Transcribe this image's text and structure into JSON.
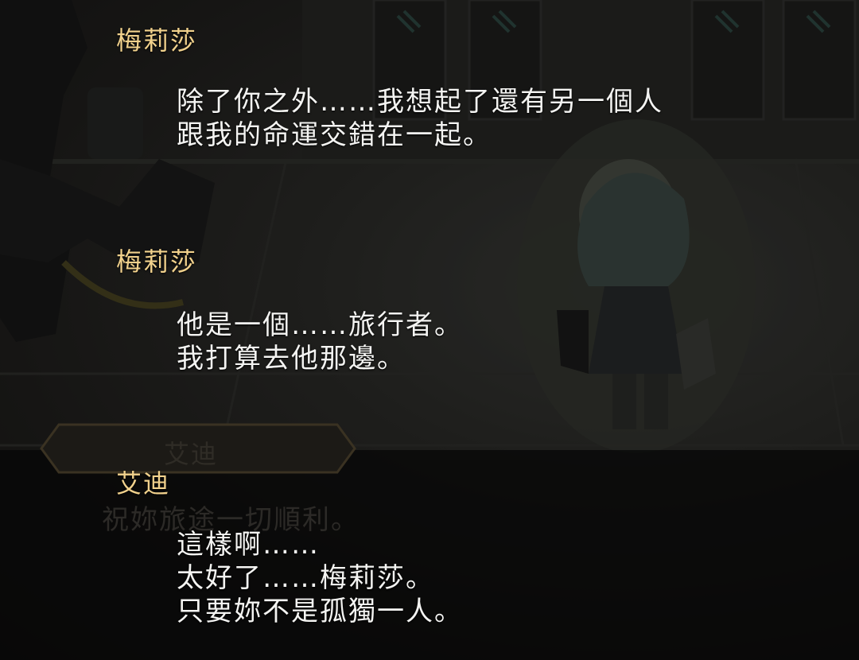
{
  "dialogue_log": [
    {
      "speaker": "梅莉莎",
      "lines": [
        "除了你之外……我想起了還有另一個人",
        "跟我的命運交錯在一起。"
      ]
    },
    {
      "speaker": "梅莉莎",
      "lines": [
        "他是一個……旅行者。",
        "我打算去他那邊。"
      ]
    },
    {
      "speaker": "艾迪",
      "lines": [
        "這樣啊……",
        "太好了……梅莉莎。",
        "只要妳不是孤獨一人。"
      ]
    }
  ],
  "background_dialogue": {
    "name": "艾迪",
    "line": "祝妳旅途一切順利。"
  },
  "colors": {
    "speaker_name": "#f1d18c",
    "dialogue_text": "#f4f4f2"
  }
}
